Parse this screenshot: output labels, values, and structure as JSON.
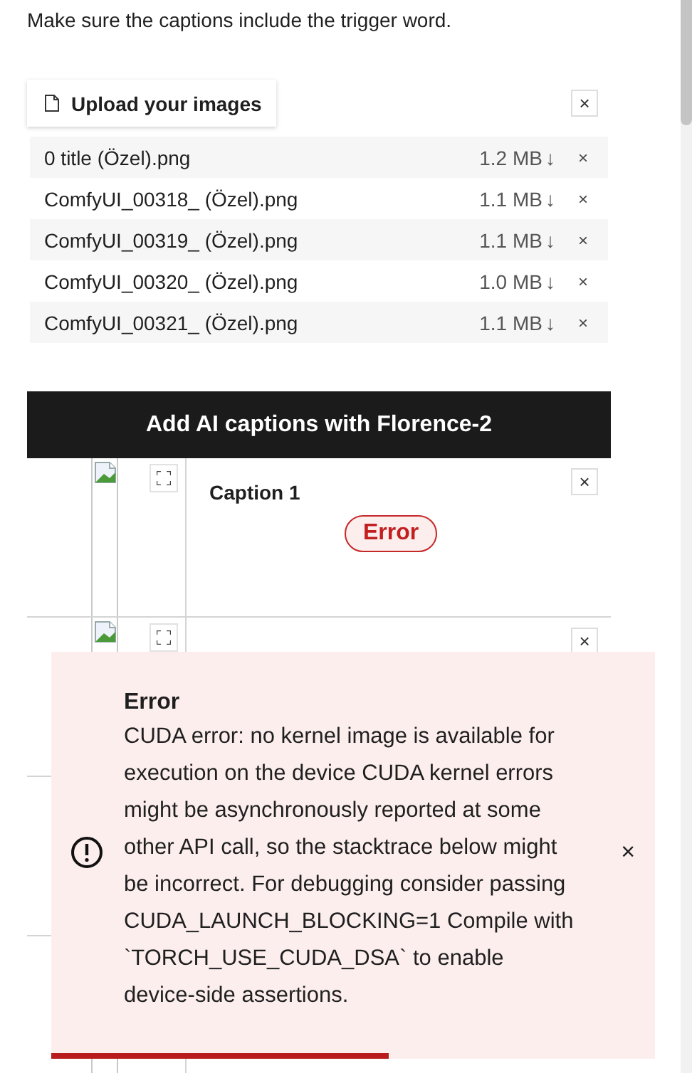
{
  "instructions": "Make sure the captions include the trigger word.",
  "uploader": {
    "tab_label": "Upload your images",
    "clear": "×",
    "files": [
      {
        "name": "0 title (Özel).png",
        "size": "1.2 MB",
        "download": "↓",
        "remove": "×"
      },
      {
        "name": "ComfyUI_00318_ (Özel).png",
        "size": "1.1 MB",
        "download": "↓",
        "remove": "×"
      },
      {
        "name": "ComfyUI_00319_ (Özel).png",
        "size": "1.1 MB",
        "download": "↓",
        "remove": "×"
      },
      {
        "name": "ComfyUI_00320_ (Özel).png",
        "size": "1.0 MB",
        "download": "↓",
        "remove": "×"
      },
      {
        "name": "ComfyUI_00321_ (Özel).png",
        "size": "1.1 MB",
        "download": "↓",
        "remove": "×"
      }
    ]
  },
  "caption_button": "Add AI captions with Florence-2",
  "gallery": {
    "items": [
      {
        "kind": "full",
        "caption_label": "Caption 1",
        "status": "Error",
        "remove": "×"
      },
      {
        "kind": "partial",
        "remove": "×"
      },
      {
        "kind": "covered"
      },
      {
        "kind": "covered"
      }
    ]
  },
  "toast": {
    "title": "Error",
    "message": "CUDA error: no kernel image is available for execution on the device CUDA kernel errors might be asynchronously reported at some other API call, so the stacktrace below might be incorrect. For debugging consider passing CUDA_LAUNCH_BLOCKING=1 Compile with `TORCH_USE_CUDA_DSA` to enable device-side assertions.",
    "close": "×",
    "level": 0.56
  }
}
